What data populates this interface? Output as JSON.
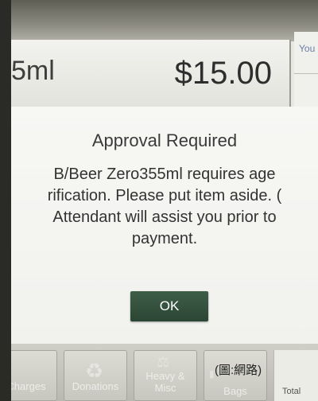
{
  "item": {
    "name_fragment": "5ml",
    "price": "$15.00"
  },
  "side_panel": {
    "label_fragment": "You"
  },
  "dialog": {
    "title": "Approval Required",
    "message_lines": [
      "B/Beer Zero355ml requires age",
      "rification.  Please put item aside.  (",
      "Attendant will assist you prior to",
      "payment."
    ],
    "ok_label": "OK"
  },
  "bottom_bar": {
    "buttons": [
      {
        "label": "Charges"
      },
      {
        "label": "Donations"
      },
      {
        "label": "Heavy & Misc"
      },
      {
        "label": "Bags"
      }
    ],
    "total_label": "Total"
  },
  "watermark": "(圖:網路)",
  "colors": {
    "ok_button": "#2f4a38",
    "side_label": "#6b7fa6"
  },
  "icons": {
    "donations": "recycle-icon",
    "heavy_misc": "scale-icon",
    "bags": "bag-icon"
  }
}
